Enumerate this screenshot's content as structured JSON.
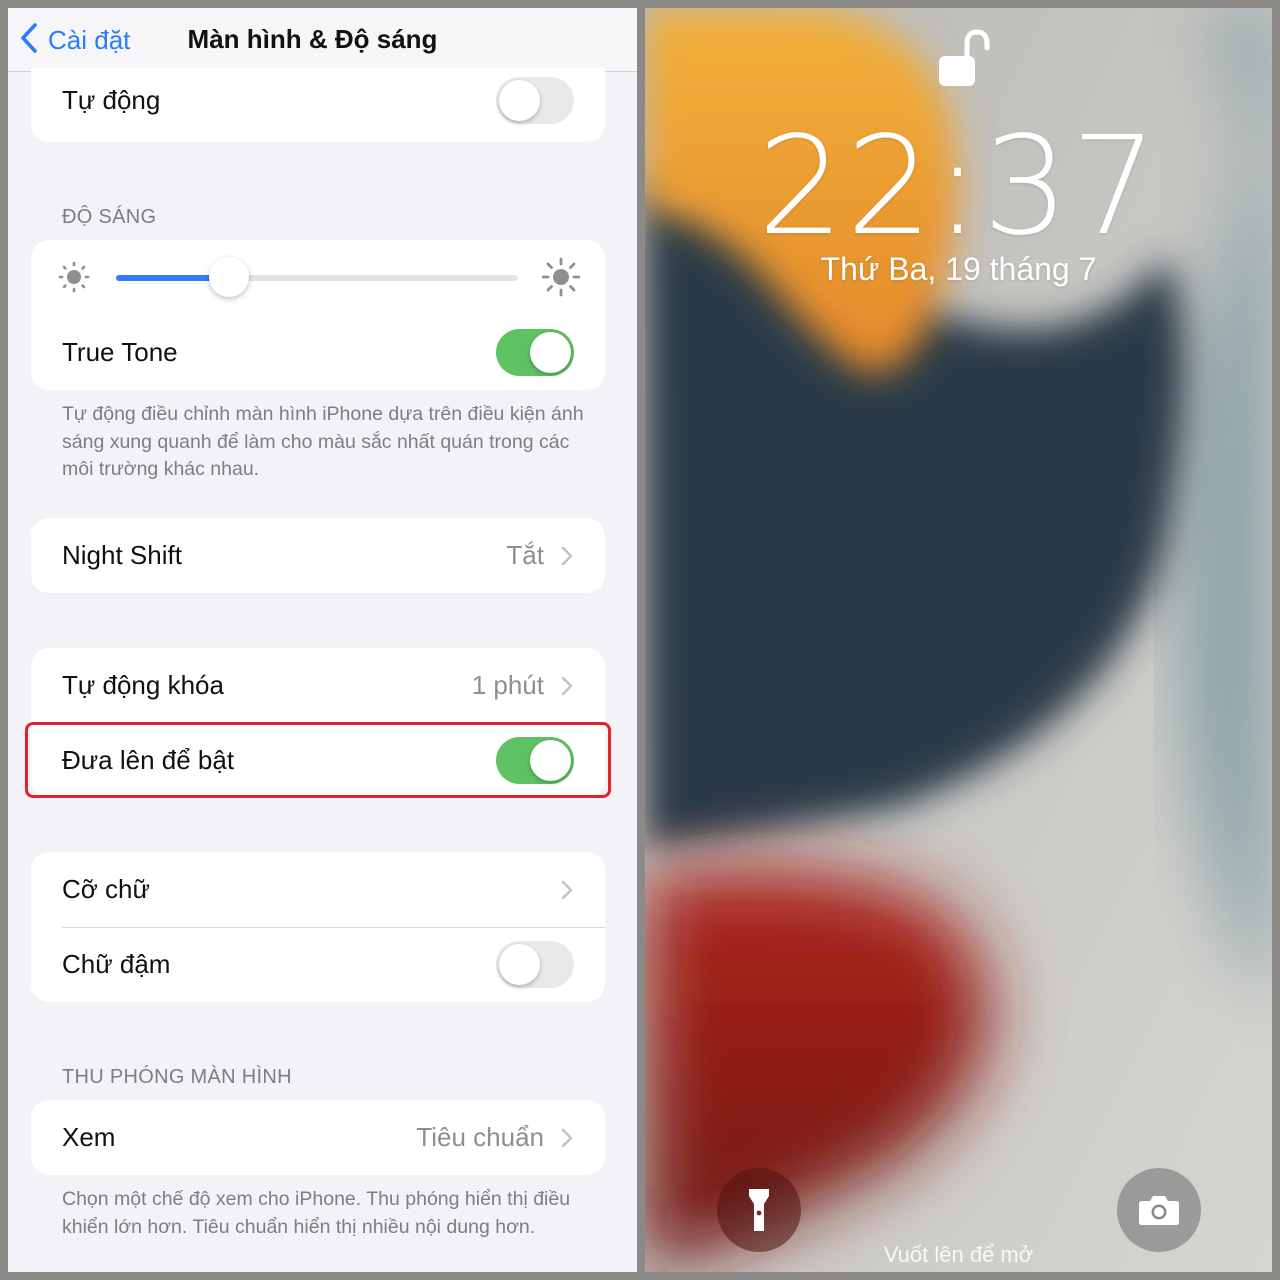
{
  "settings": {
    "back_label": "Cài đặt",
    "title": "Màn hình & Độ sáng",
    "auto_row": {
      "label": "Tự động",
      "enabled": false
    },
    "brightness": {
      "header": "ĐỘ SÁNG",
      "level": 0.28,
      "true_tone_label": "True Tone",
      "true_tone_enabled": true,
      "true_tone_footnote": "Tự động điều chỉnh màn hình iPhone dựa trên điều kiện ánh sáng xung quanh để làm cho màu sắc nhất quán trong các môi trường khác nhau."
    },
    "night_shift": {
      "label": "Night Shift",
      "value": "Tắt"
    },
    "auto_lock": {
      "label": "Tự động khóa",
      "value": "1 phút"
    },
    "raise_to_wake": {
      "label": "Đưa lên để bật",
      "enabled": true
    },
    "text_size": {
      "label": "Cỡ chữ"
    },
    "bold_text": {
      "label": "Chữ đậm",
      "enabled": false
    },
    "zoom": {
      "header": "THU PHÓNG MÀN HÌNH",
      "view_label": "Xem",
      "view_value": "Tiêu chuẩn",
      "footnote": "Chọn một chế độ xem cho iPhone. Thu phóng hiển thị điều khiển lớn hơn. Tiêu chuẩn hiển thị nhiều nội dung hơn."
    }
  },
  "lockscreen": {
    "time": "22:37",
    "date": "Thứ Ba, 19 tháng 7",
    "swipe_hint": "Vuốt lên để mở",
    "quick_actions": [
      "flashlight-icon",
      "camera-icon"
    ]
  },
  "colors": {
    "accent_blue": "#2f7cf6",
    "toggle_on": "#5ec162",
    "highlight_red": "#e0232c"
  }
}
